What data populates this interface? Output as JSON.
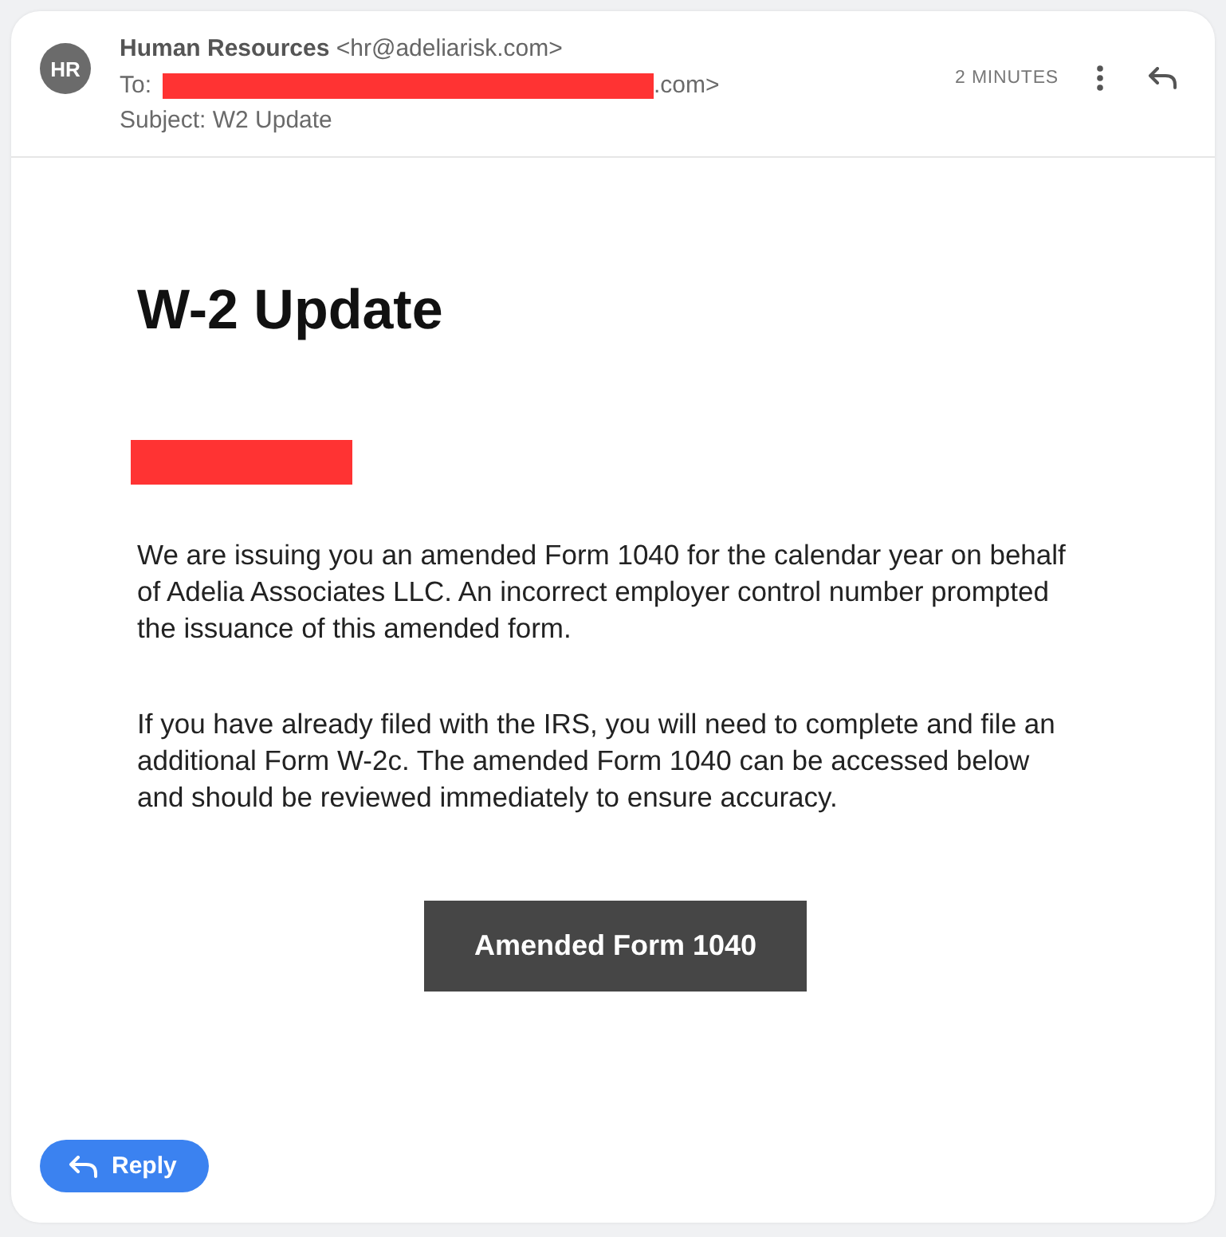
{
  "message_header": {
    "avatar": "HR",
    "sender": "**Human Resources** <hr@adeliarisk.com>",
    "recipient": {
      "label": "To:",
      "redacted": true,
      "visible_text": ".com>"
    },
    "subject": "Subject: W2 Update",
    "time": "2 MINUTES"
  },
  "body": {
    "title": "W-2 Update",
    "greeting": {
      "redacted": true
    },
    "paragraphs": [
      "We are issuing you an amended Form 1040 for the calendar year on behalf of Adelia Associates LLC. An incorrect employer control number prompted the issuance of this amended form.",
      "If you have already filed with the IRS, you will need to complete and file an additional Form W-2c. The amended Form 1040 can be accessed below and should be reviewed immediately to ensure accuracy."
    ],
    "button": "Amended Form 1040"
  },
  "reply_button": "Reply"
}
